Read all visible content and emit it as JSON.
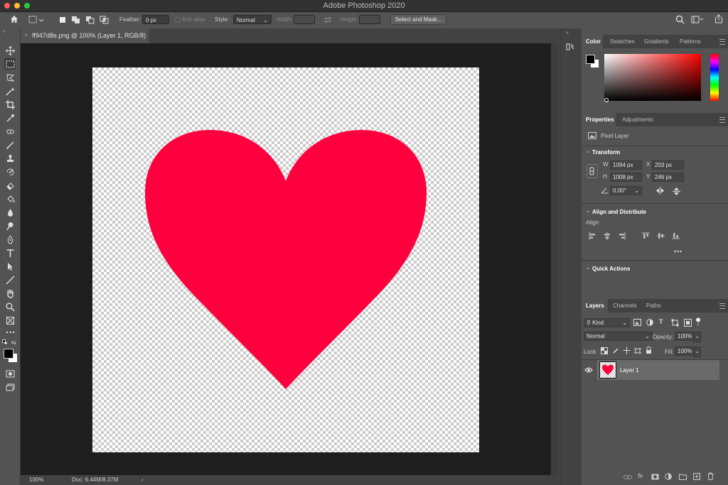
{
  "window": {
    "title": "Adobe Photoshop 2020"
  },
  "options_bar": {
    "feather_label": "Feather:",
    "feather_value": "0 px",
    "antialias_label": "Anti-alias",
    "style_label": "Style:",
    "style_value": "Normal",
    "width_label": "Width:",
    "height_label": "Height:",
    "select_mask_button": "Select and Mask..."
  },
  "document": {
    "tab_label": "ff947d8e.png @ 100% (Layer 1, RGB/8)",
    "zoom": "100%",
    "doc_size": "Doc: 6.44M/8.37M"
  },
  "canvas": {
    "heart_color": "#ff003f"
  },
  "color_panel": {
    "tabs": [
      "Color",
      "Swatches",
      "Gradients",
      "Patterns"
    ],
    "foreground_color": "#000000",
    "background_color": "#ffffff"
  },
  "properties_panel": {
    "tabs": [
      "Properties",
      "Adjustments"
    ],
    "layer_type": "Pixel Layer",
    "transform_header": "Transform",
    "w_label": "W",
    "w_value": "1094 px",
    "h_label": "H",
    "h_value": "1008 px",
    "x_label": "X",
    "x_value": "203 px",
    "y_label": "Y",
    "y_value": "246 px",
    "angle_value": "0.00°",
    "align_header": "Align and Distribute",
    "align_label": "Align:",
    "quick_actions_header": "Quick Actions"
  },
  "layers_panel": {
    "tabs": [
      "Layers",
      "Channels",
      "Paths"
    ],
    "filter_value": "Kind",
    "blend_mode": "Normal",
    "opacity_label": "Opacity:",
    "opacity_value": "100%",
    "lock_label": "Lock:",
    "fill_label": "Fill:",
    "fill_value": "100%",
    "layers": [
      {
        "name": "Layer 1",
        "visible": true
      }
    ]
  },
  "icons": [
    "home-icon",
    "marquee-icon",
    "move-icon",
    "lasso-icon",
    "magic-wand-icon",
    "crop-icon",
    "eyedropper-icon",
    "brush-icon",
    "stamp-icon",
    "eraser-icon",
    "gradient-icon",
    "pen-icon",
    "type-icon",
    "hand-icon",
    "zoom-icon",
    "search-icon",
    "share-icon",
    "eye-icon",
    "link-icon",
    "fx-icon",
    "trash-icon"
  ]
}
